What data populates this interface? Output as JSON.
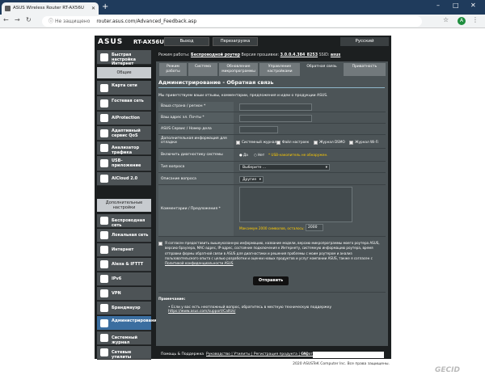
{
  "browser": {
    "tab_title": "ASUS Wireless Router RT-AX56U",
    "not_secure": "Не защищено",
    "url": "router.asus.com/Advanced_Feedback.asp",
    "new_tab": "+",
    "avatar_letter": "A"
  },
  "router": {
    "logo": "ASUS",
    "model": "RT-AX56U",
    "logout": "Выход",
    "reboot": "Перезагрузка",
    "language": "Русский",
    "status_mode_label": "Режим работы:",
    "status_mode": "Беспроводной роутер",
    "status_fw_label": "Версия прошивки:",
    "status_fw": "3.0.0.4.384_8253",
    "status_ssid_label": "SSID:",
    "status_ssid": "asus"
  },
  "sidebar": {
    "quick_setup": "Быстрая настройка Интернет",
    "general_header": "Общие",
    "general_items": [
      "Карта сети",
      "Гостевая сеть",
      "AiProtection",
      "Адаптивный сервис QoS",
      "Анализатор трафика",
      "USB-приложение",
      "AiCloud 2.0"
    ],
    "advanced_header": "Дополнительные настройки",
    "advanced_items": [
      "Беспроводная сеть",
      "Локальная сеть",
      "Интернет",
      "Alexa & IFTTT",
      "IPv6",
      "VPN",
      "Брандмауэр",
      "Администрирование",
      "Системный журнал",
      "Сетевые утилиты"
    ]
  },
  "tabs": [
    "Режим работы",
    "Система",
    "Обновление микропрограммы",
    "Управление настройками",
    "Обратная связь",
    "Приватность"
  ],
  "panel": {
    "title": "Администрирование - Обратная связь",
    "description": "Мы приветствуем ваши отзывы, комментарии, предложения и идеи о продукции ASUS.",
    "country_label": "Ваша страна / регион *",
    "email_label": "Ваш адрес эл. Почты *",
    "isp_label": "ASUS Сервис / Номер дела",
    "extra_label": "Дополнительная информация для отладки",
    "extra_opts": [
      "Системный журнал",
      "Файл настроек",
      "Журнал DSMO",
      "Журнал Wi-Fi"
    ],
    "diag_label": "Включить диагностику системы",
    "diag_yes": "Да",
    "diag_no": "Нет",
    "diag_note": "* USB-накопитель не обнаружен.",
    "topic_label": "Тип вопроса",
    "topic_value": "Выберите ...",
    "subtopic_label": "Описание вопроса",
    "subtopic_value": "Другие",
    "comments_label": "Комментарии / Предложения *",
    "max_chars": "Максимум 2000 символов, осталось:",
    "chars_left": "2000",
    "consent": "Я согласен предоставить вышеуказанную информацию, название модели, версию микропрограммы моего роутера ASUS, версию браузера, MAC-адрес, IP-адрес, состояние подключения к Интернету, системную информацию роутера, время отправки формы обратной связи в ASUS для диагностики и решения проблемы с моим роутером и анализ пользовательского опыта с целью разработки и оценки новых продуктов и услуг компании ASUS, также я согласен с",
    "consent_link": "Политикой конфиденциальности ASUS",
    "send": "Отправить",
    "notes_title": "Примечание:",
    "notes_text": "Если у вас есть неотложный вопрос, обратитесь в местную техническую поддержку",
    "notes_link": "https://www.asus.com/support/CallUs/"
  },
  "footer": {
    "help": "Помощь & Поддержка",
    "links": "Руководство | Утилиты | Регистрация продукта | Обратная связь",
    "faq": "FAQ",
    "copyright": "2020 ASUSTeK Computer Inc. Все права защищены."
  },
  "watermark": "GECID"
}
